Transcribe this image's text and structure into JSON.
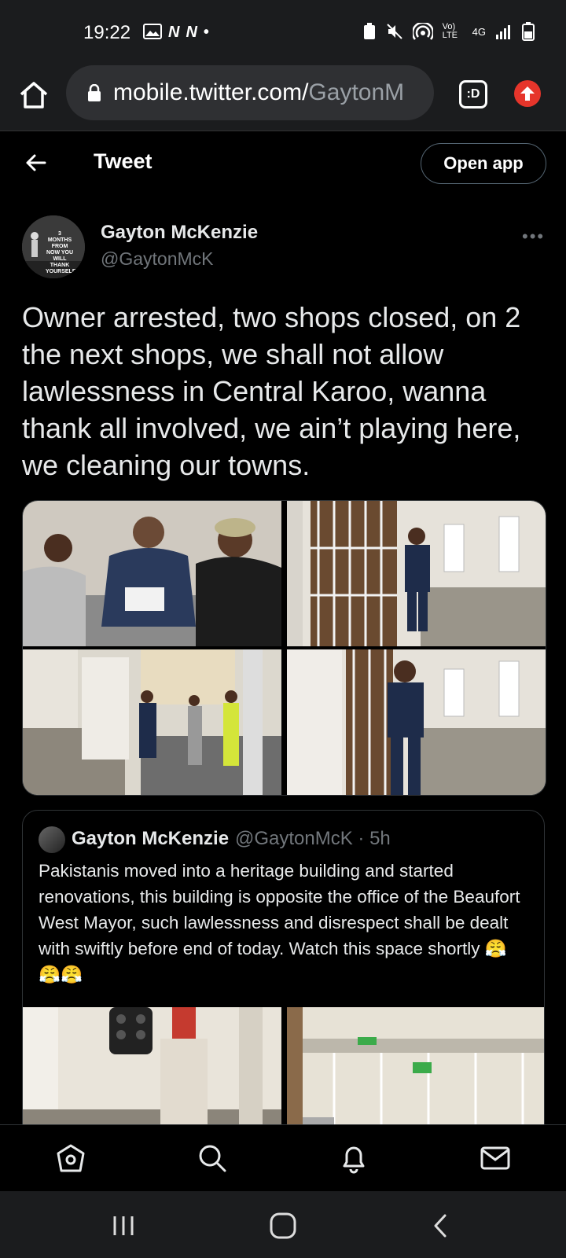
{
  "status_bar": {
    "time": "19:22",
    "left_icons": [
      "image-icon",
      "N",
      "N",
      "•"
    ],
    "network": "4G",
    "volte": "Vo) LTE"
  },
  "browser": {
    "url_host": "mobile.twitter.com/",
    "url_path": "GaytonM",
    "tabs_label": ":D"
  },
  "header": {
    "title": "Tweet",
    "open_app": "Open app"
  },
  "tweet": {
    "author_name": "Gayton McKenzie",
    "author_handle": "@GaytonMcK",
    "avatar_caption": "3 MONTHS FROM NOW YOU WILL THANK YOURSELF",
    "more": "•••",
    "text": "Owner arrested, two shops closed, on 2 the next shops, we shall not allow lawlessness in Central Karoo, wanna thank all involved, we ain’t playing here, we cleaning our towns.",
    "media_count": 4
  },
  "quoted_tweet": {
    "author_name": "Gayton McKenzie",
    "handle_time": "@GaytonMcK · 5h",
    "text": "Pakistanis moved into a heritage building and started renovations, this building is opposite the office of the Beaufort West Mayor, such lawlessness and disrespect shall be dealt with swiftly before end of today. Watch this space shortly 😤😤😤"
  },
  "bottom_nav": [
    "home-icon",
    "search-icon",
    "bell-icon",
    "mail-icon"
  ],
  "colors": {
    "background": "#000000",
    "border": "#2f3336",
    "muted": "#71767b",
    "text": "#e7e9ea",
    "update": "#e6352b"
  }
}
